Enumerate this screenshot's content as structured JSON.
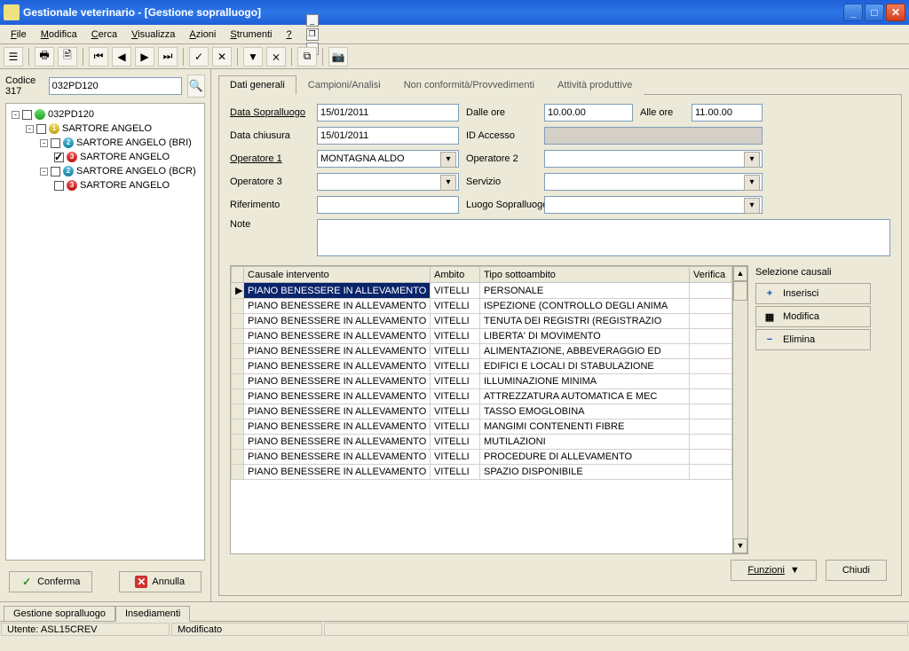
{
  "window": {
    "title": "Gestionale veterinario - [Gestione sopralluogo]"
  },
  "menu": {
    "items": [
      "File",
      "Modifica",
      "Cerca",
      "Visualizza",
      "Azioni",
      "Strumenti",
      "?"
    ]
  },
  "leftpanel": {
    "codice_label": "Codice 317",
    "codice_value": "032PD120",
    "tree": {
      "root": "032PD120",
      "n1": "SARTORE ANGELO",
      "n2a": "SARTORE ANGELO (BRI)",
      "n3a": "SARTORE ANGELO",
      "n2b": "SARTORE ANGELO (BCR)",
      "n3b": "SARTORE ANGELO"
    },
    "conferma": "Conferma",
    "annulla": "Annulla"
  },
  "tabs": {
    "t0": "Dati generali",
    "t1": "Campioni/Analisi",
    "t2": "Non conformità/Provvedimenti",
    "t3": "Attività produttive"
  },
  "form": {
    "data_sopralluogo_lbl": "Data Sopralluogo",
    "data_sopralluogo_val": "15/01/2011",
    "dalle_ore_lbl": "Dalle ore",
    "dalle_ore_val": "10.00.00",
    "alle_ore_lbl": "Alle ore",
    "alle_ore_val": "11.00.00",
    "data_chiusura_lbl": "Data chiusura",
    "data_chiusura_val": "15/01/2011",
    "id_accesso_lbl": "ID Accesso",
    "id_accesso_val": "",
    "op1_lbl": "Operatore 1",
    "op1_val": "MONTAGNA ALDO",
    "op2_lbl": "Operatore 2",
    "op2_val": "",
    "op3_lbl": "Operatore 3",
    "op3_val": "",
    "servizio_lbl": "Servizio",
    "servizio_val": "",
    "rif_lbl": "Riferimento",
    "rif_val": "",
    "luogo_lbl": "Luogo Sopralluogo",
    "luogo_val": "",
    "note_lbl": "Note",
    "note_val": ""
  },
  "grid": {
    "h_causale": "Causale intervento",
    "h_ambito": "Ambito",
    "h_tipo": "Tipo sottoambito",
    "h_verifica": "Verifica",
    "rows": [
      {
        "c": "PIANO BENESSERE IN ALLEVAMENTO",
        "a": "VITELLI",
        "t": "PERSONALE"
      },
      {
        "c": "PIANO BENESSERE IN ALLEVAMENTO",
        "a": "VITELLI",
        "t": "ISPEZIONE (CONTROLLO DEGLI ANIMA"
      },
      {
        "c": "PIANO BENESSERE IN ALLEVAMENTO",
        "a": "VITELLI",
        "t": "TENUTA DEI REGISTRI (REGISTRAZIO"
      },
      {
        "c": "PIANO BENESSERE IN ALLEVAMENTO",
        "a": "VITELLI",
        "t": "LIBERTA' DI MOVIMENTO"
      },
      {
        "c": "PIANO BENESSERE IN ALLEVAMENTO",
        "a": "VITELLI",
        "t": "ALIMENTAZIONE, ABBEVERAGGIO ED"
      },
      {
        "c": "PIANO BENESSERE IN ALLEVAMENTO",
        "a": "VITELLI",
        "t": "EDIFICI E LOCALI DI STABULAZIONE"
      },
      {
        "c": "PIANO BENESSERE IN ALLEVAMENTO",
        "a": "VITELLI",
        "t": "ILLUMINAZIONE MINIMA"
      },
      {
        "c": "PIANO BENESSERE IN ALLEVAMENTO",
        "a": "VITELLI",
        "t": "ATTREZZATURA AUTOMATICA E MEC"
      },
      {
        "c": "PIANO BENESSERE IN ALLEVAMENTO",
        "a": "VITELLI",
        "t": "TASSO EMOGLOBINA"
      },
      {
        "c": "PIANO BENESSERE IN ALLEVAMENTO",
        "a": "VITELLI",
        "t": "MANGIMI CONTENENTI FIBRE"
      },
      {
        "c": "PIANO BENESSERE IN ALLEVAMENTO",
        "a": "VITELLI",
        "t": "MUTILAZIONI"
      },
      {
        "c": "PIANO BENESSERE IN ALLEVAMENTO",
        "a": "VITELLI",
        "t": "PROCEDURE DI ALLEVAMENTO"
      },
      {
        "c": "PIANO BENESSERE IN ALLEVAMENTO",
        "a": "VITELLI",
        "t": "SPAZIO DISPONIBILE"
      }
    ]
  },
  "side": {
    "title": "Selezione causali",
    "ins": "Inserisci",
    "mod": "Modifica",
    "del": "Elimina"
  },
  "footer": {
    "funzioni": "Funzioni",
    "chiudi": "Chiudi"
  },
  "bottomtabs": {
    "t0": "Gestione sopralluogo",
    "t1": "Insediamenti"
  },
  "status": {
    "user": "Utente: ASL15CREV",
    "state": "Modificato"
  }
}
